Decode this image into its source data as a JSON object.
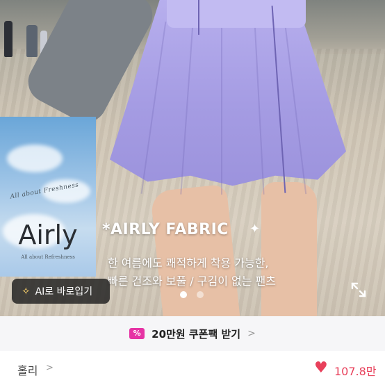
{
  "hero": {
    "fabric_title": "*AIRLY FABRIC",
    "description_line1": "한 여름에도 쾌적하게 착용 가능한,",
    "description_line2": "빠른 건조와 보풀 / 구김이 없는 팬츠",
    "brand_card": {
      "arc_text": "All about Freshness",
      "name": "Airly",
      "subtitle": "All about Refreshness"
    },
    "ai_button_label": "AI로 바로입기",
    "carousel": {
      "total": 2,
      "active": 1
    }
  },
  "coupon": {
    "icon_text": "%",
    "label": "20만원 쿠폰팩 받기"
  },
  "footer": {
    "seller_name": "홀리",
    "like_count": "107.8만"
  },
  "colors": {
    "accent_pink": "#e633a4",
    "heart_red": "#e8405b"
  }
}
